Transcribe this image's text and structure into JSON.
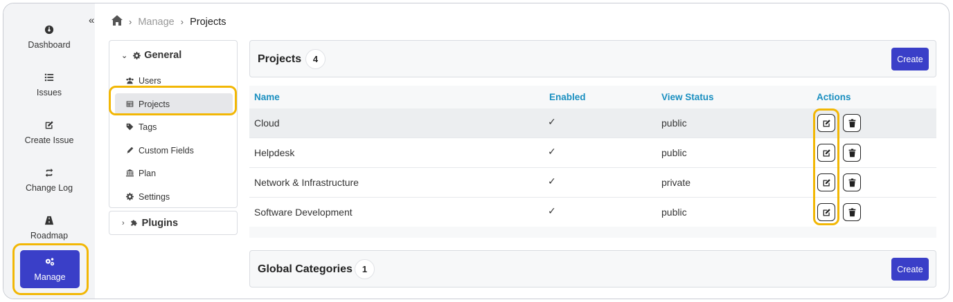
{
  "nav": {
    "collapse_icon": "double-chevron-left-icon",
    "items": [
      {
        "label": "Dashboard",
        "icon": "dashboard-icon"
      },
      {
        "label": "Issues",
        "icon": "list-icon"
      },
      {
        "label": "Create Issue",
        "icon": "edit-icon"
      },
      {
        "label": "Change Log",
        "icon": "repeat-icon"
      },
      {
        "label": "Roadmap",
        "icon": "road-icon"
      }
    ],
    "active": {
      "label": "Manage",
      "icon": "gears-icon"
    }
  },
  "breadcrumb": {
    "home_icon": "home-icon",
    "items": [
      "Manage",
      "Projects"
    ]
  },
  "menu": {
    "general": {
      "label": "General",
      "icon": "cog-icon"
    },
    "items": [
      {
        "label": "Users",
        "icon": "users-icon"
      },
      {
        "label": "Projects",
        "icon": "table-icon"
      },
      {
        "label": "Tags",
        "icon": "tags-icon"
      },
      {
        "label": "Custom Fields",
        "icon": "pencil-icon"
      },
      {
        "label": "Plan",
        "icon": "bank-icon"
      },
      {
        "label": "Settings",
        "icon": "cog-icon"
      }
    ],
    "active_item": "Projects",
    "plugins": {
      "label": "Plugins",
      "icon": "puzzle-icon"
    }
  },
  "projects_panel": {
    "title": "Projects",
    "count": "4",
    "create_label": "Create"
  },
  "table": {
    "columns": [
      "Name",
      "Enabled",
      "View Status",
      "Actions"
    ],
    "rows": [
      {
        "name": "Cloud",
        "enabled": "✓",
        "status": "public"
      },
      {
        "name": "Helpdesk",
        "enabled": "✓",
        "status": "public"
      },
      {
        "name": "Network & Infrastructure",
        "enabled": "✓",
        "status": "private"
      },
      {
        "name": "Software Development",
        "enabled": "✓",
        "status": "public"
      }
    ]
  },
  "categories_panel": {
    "title": "Global Categories",
    "count": "1",
    "create_label": "Create"
  },
  "colors": {
    "accent": "#3a3fc8",
    "highlight": "#f2b705",
    "header_link": "#1a8fc0"
  }
}
